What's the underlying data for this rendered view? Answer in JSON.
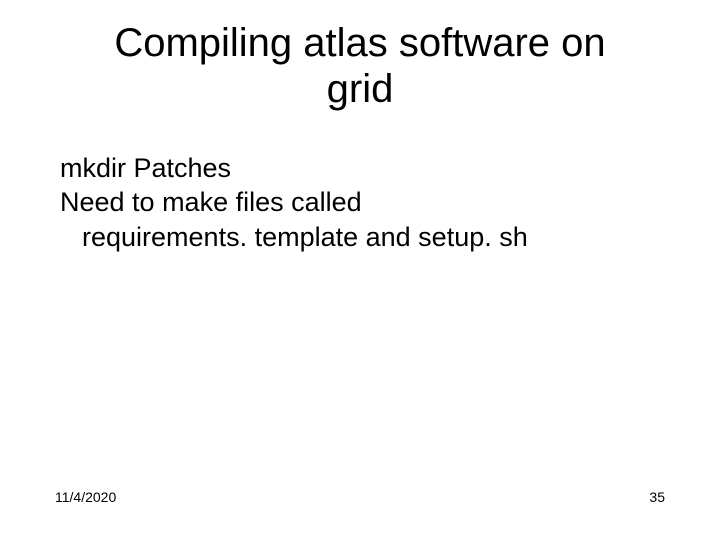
{
  "title": "Compiling atlas software on grid",
  "body": {
    "line1": "mkdir Patches",
    "line2": "Need to make files called",
    "line3": "requirements. template and setup. sh"
  },
  "footer": {
    "date": "11/4/2020",
    "page": "35"
  }
}
